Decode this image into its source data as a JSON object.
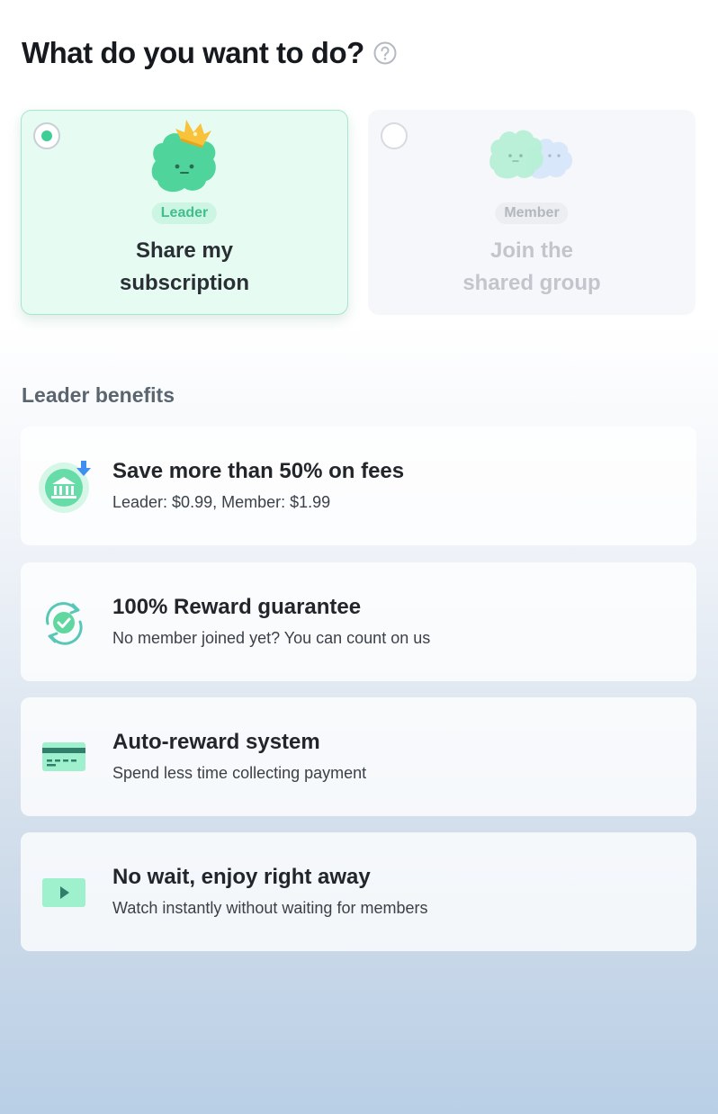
{
  "page": {
    "title": "What do you want to do?"
  },
  "roles": {
    "leader": {
      "badge": "Leader",
      "line1": "Share my",
      "line2": "subscription",
      "selected": true
    },
    "member": {
      "badge": "Member",
      "line1": "Join the",
      "line2": "shared group",
      "selected": false
    }
  },
  "benefits_section": {
    "title": "Leader benefits"
  },
  "benefits": [
    {
      "title": "Save more than 50% on fees",
      "desc": "Leader: $0.99, Member: $1.99",
      "icon": "bank-savings-icon"
    },
    {
      "title": "100% Reward guarantee",
      "desc": "No member joined yet? You can count on us",
      "icon": "reward-guarantee-icon"
    },
    {
      "title": "Auto-reward system",
      "desc": "Spend less time collecting payment",
      "icon": "card-icon"
    },
    {
      "title": "No wait, enjoy right away",
      "desc": "Watch instantly without waiting for members",
      "icon": "play-icon"
    }
  ],
  "colors": {
    "accent": "#3fcf96",
    "leader_bg": "#e6fbf2",
    "member_bg": "#f5f7fa"
  }
}
